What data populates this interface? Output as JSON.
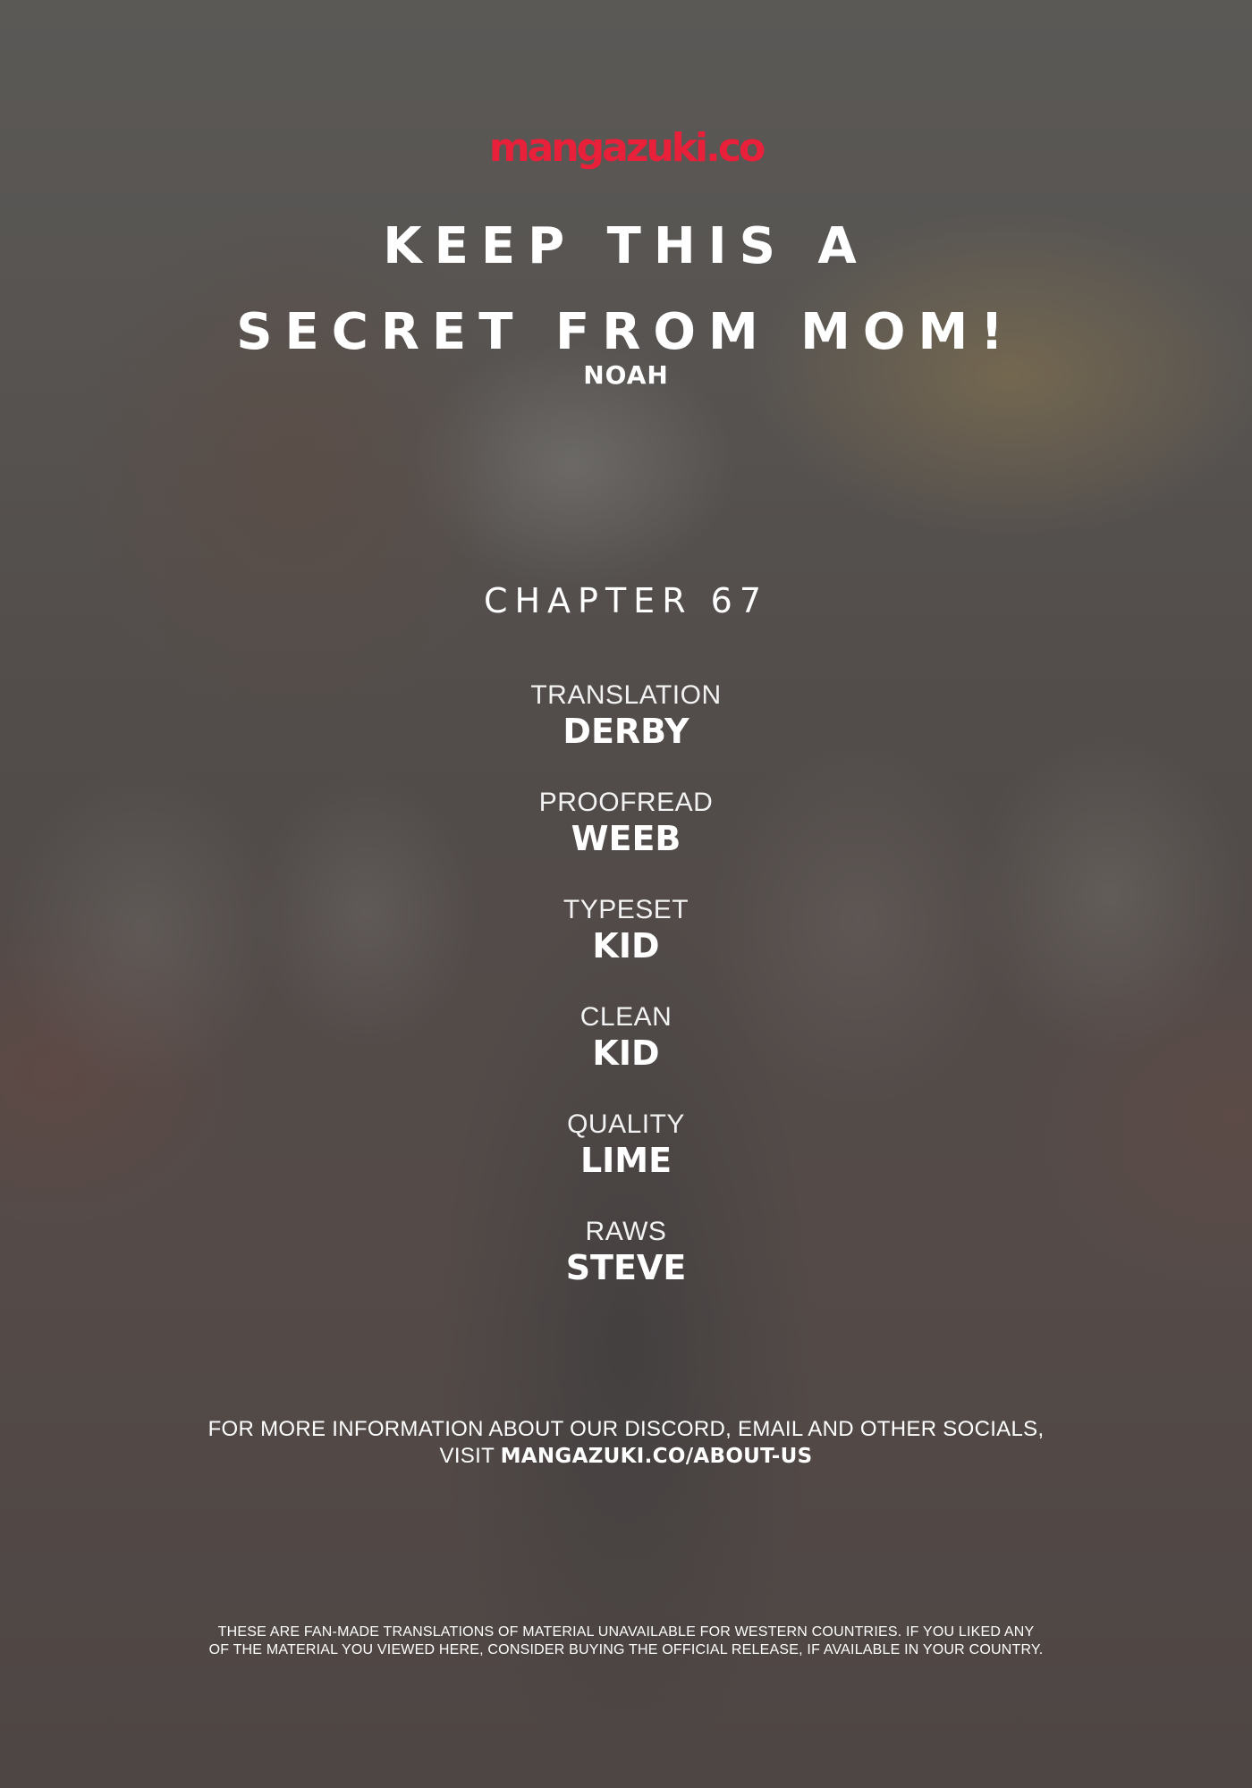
{
  "logo": {
    "text": "mangazuki.co",
    "color": "#e8203a"
  },
  "title": {
    "line1": "KEEP THIS A",
    "line2": "SECRET FROM MOM!"
  },
  "author": "NOAH",
  "chapter": "CHAPTER 67",
  "credits": [
    {
      "role": "TRANSLATION",
      "name": "DERBY"
    },
    {
      "role": "PROOFREAD",
      "name": "WEEB"
    },
    {
      "role": "TYPESET",
      "name": "KID"
    },
    {
      "role": "CLEAN",
      "name": "KID"
    },
    {
      "role": "QUALITY",
      "name": "LIME"
    },
    {
      "role": "RAWS",
      "name": "STEVE"
    }
  ],
  "info": {
    "line1": "FOR MORE INFORMATION ABOUT OUR DISCORD, EMAIL AND OTHER SOCIALS,",
    "line2_prefix": "VISIT",
    "line2_link": "MANGAZUKI.CO/ABOUT-US"
  },
  "disclaimer": {
    "line1": "THESE ARE FAN-MADE TRANSLATIONS OF MATERIAL UNAVAILABLE FOR WESTERN COUNTRIES. IF YOU LIKED ANY",
    "line2": "OF THE MATERIAL YOU VIEWED HERE, CONSIDER BUYING THE OFFICIAL RELEASE, IF AVAILABLE IN YOUR COUNTRY."
  }
}
